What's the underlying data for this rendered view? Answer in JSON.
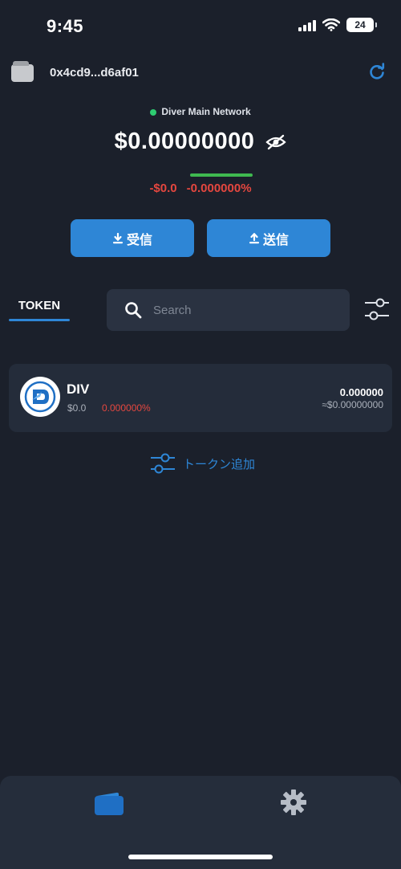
{
  "status_bar": {
    "time": "9:45",
    "battery": "24"
  },
  "header": {
    "address": "0x4cd9...d6af01"
  },
  "network": {
    "name": "Diver Main Network",
    "status_color": "#2ecc71"
  },
  "balance": {
    "total": "$0.00000000",
    "change_fiat": "-$0.0",
    "change_percent": "-0.000000%"
  },
  "actions": {
    "receive_label": "受信",
    "send_label": "送信"
  },
  "tabs": {
    "token_label": "TOKEN"
  },
  "search": {
    "placeholder": "Search"
  },
  "tokens": [
    {
      "symbol": "DIV",
      "fiat_value": "$0.0",
      "change": "0.000000%",
      "amount": "0.000000",
      "amount_fiat": "≈$0.00000000"
    }
  ],
  "add_token": {
    "label": "トークン追加"
  },
  "colors": {
    "accent": "#2e86d6",
    "negative": "#e5473f",
    "positive": "#3fb950",
    "background": "#1b202b"
  },
  "bottom_nav": {
    "items": [
      "wallet-icon",
      "gear-icon"
    ],
    "active": "wallet-icon"
  }
}
